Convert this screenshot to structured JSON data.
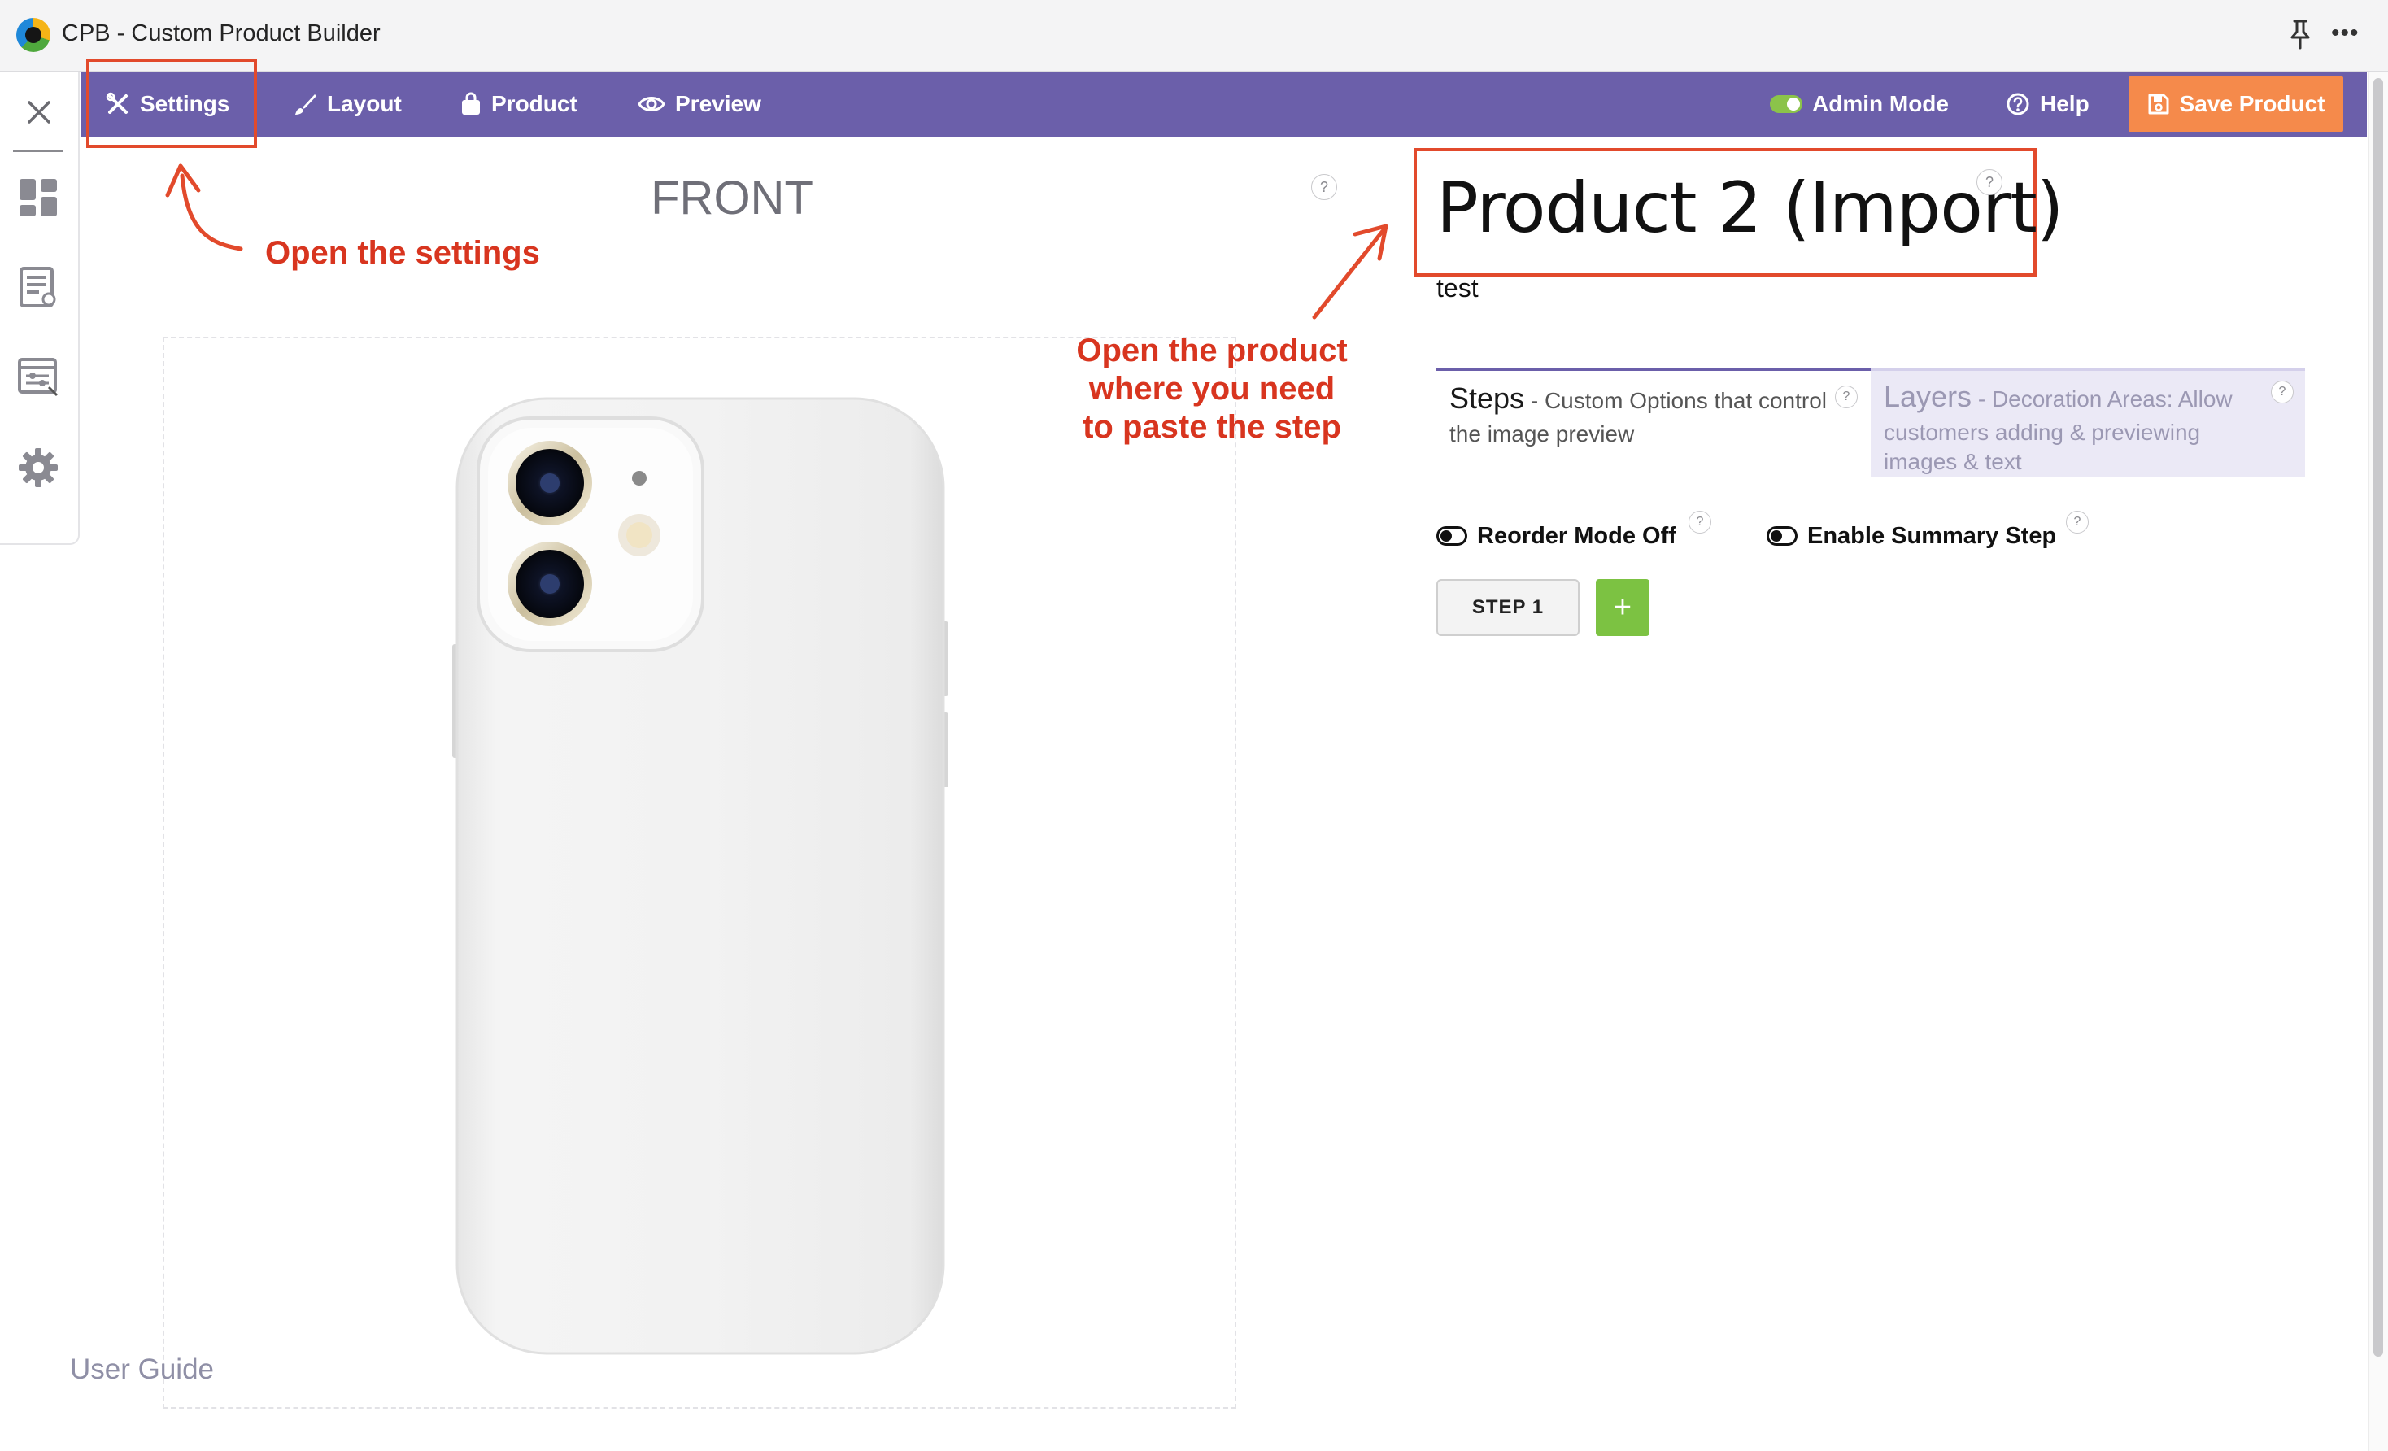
{
  "window": {
    "title": "CPB - Custom Product Builder",
    "more_glyph": "•••"
  },
  "sidebar": {
    "items": [
      {
        "icon": "close-icon"
      },
      {
        "icon": "dashboard-icon"
      },
      {
        "icon": "product-list-icon"
      },
      {
        "icon": "sliders-icon"
      },
      {
        "icon": "gear-icon"
      }
    ]
  },
  "navbar": {
    "settings": "Settings",
    "layout": "Layout",
    "product": "Product",
    "preview": "Preview",
    "admin_mode": "Admin Mode",
    "help": "Help",
    "save": "Save Product",
    "color": "#6b5faa",
    "save_color": "#f58a4b"
  },
  "canvas": {
    "view_label": "FRONT",
    "help_glyph": "?",
    "user_guide": "User Guide"
  },
  "annotations": {
    "settings_note": "Open the settings",
    "product_note": [
      "Open the product",
      "where you need",
      "to paste the step"
    ],
    "color": "#d8351f"
  },
  "product": {
    "title": "Product 2 (Import)",
    "description": "test",
    "tabs": {
      "steps": {
        "name": "Steps",
        "desc_line1": " - Custom Options that control",
        "desc_line2": "the image preview"
      },
      "layers": {
        "name": "Layers",
        "desc_line1": " - Decoration Areas: Allow",
        "desc_line2": "customers adding & previewing",
        "desc_line3": "images & text"
      }
    },
    "reorder_mode": "Reorder Mode Off",
    "summary_step": "Enable Summary Step",
    "steps": [
      "STEP 1"
    ],
    "add_step": "+",
    "accent_green": "#7cc242"
  }
}
